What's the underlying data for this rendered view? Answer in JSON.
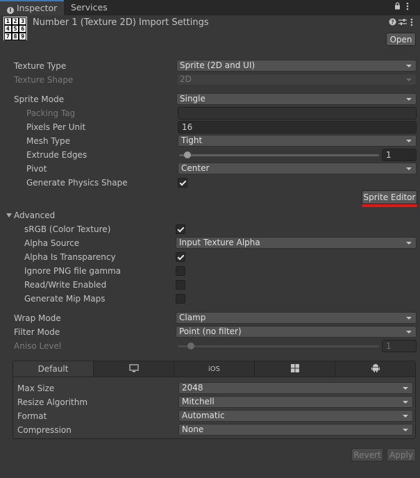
{
  "tabs": {
    "inspector": "Inspector",
    "services": "Services"
  },
  "header": {
    "thumbnail_cells": [
      "1",
      "2",
      "3",
      "4",
      "5",
      "6",
      "7",
      "8",
      "9"
    ],
    "title": "Number 1 (Texture 2D) Import Settings",
    "open_label": "Open"
  },
  "texture_type": {
    "label": "Texture Type",
    "value": "Sprite (2D and UI)"
  },
  "texture_shape": {
    "label": "Texture Shape",
    "value": "2D"
  },
  "sprite_mode": {
    "label": "Sprite Mode",
    "value": "Single"
  },
  "packing_tag": {
    "label": "Packing Tag",
    "value": ""
  },
  "pixels_per_unit": {
    "label": "Pixels Per Unit",
    "value": "16"
  },
  "mesh_type": {
    "label": "Mesh Type",
    "value": "Tight"
  },
  "extrude_edges": {
    "label": "Extrude Edges",
    "value": "1"
  },
  "pivot": {
    "label": "Pivot",
    "value": "Center"
  },
  "generate_physics_shape": {
    "label": "Generate Physics Shape",
    "checked": true
  },
  "sprite_editor_label": "Sprite Editor",
  "advanced": {
    "label": "Advanced",
    "srgb": {
      "label": "sRGB (Color Texture)",
      "checked": true
    },
    "alpha_source": {
      "label": "Alpha Source",
      "value": "Input Texture Alpha"
    },
    "alpha_is_transparency": {
      "label": "Alpha Is Transparency",
      "checked": true
    },
    "ignore_png_gamma": {
      "label": "Ignore PNG file gamma",
      "checked": false
    },
    "read_write": {
      "label": "Read/Write Enabled",
      "checked": false
    },
    "mip_maps": {
      "label": "Generate Mip Maps",
      "checked": false
    }
  },
  "wrap_mode": {
    "label": "Wrap Mode",
    "value": "Clamp"
  },
  "filter_mode": {
    "label": "Filter Mode",
    "value": "Point (no filter)"
  },
  "aniso_level": {
    "label": "Aniso Level",
    "value": "1"
  },
  "platform_tabs": {
    "default": "Default",
    "ios": "iOS"
  },
  "platform": {
    "max_size": {
      "label": "Max Size",
      "value": "2048"
    },
    "resize_algorithm": {
      "label": "Resize Algorithm",
      "value": "Mitchell"
    },
    "format": {
      "label": "Format",
      "value": "Automatic"
    },
    "compression": {
      "label": "Compression",
      "value": "None"
    }
  },
  "footer": {
    "revert_label": "Revert",
    "apply_label": "Apply"
  }
}
